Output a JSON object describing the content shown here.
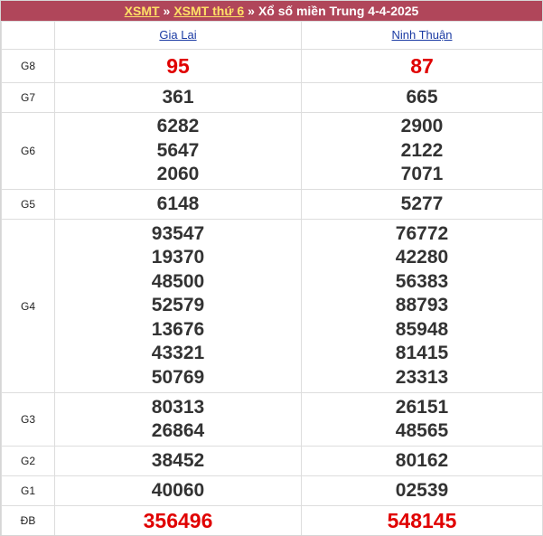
{
  "breadcrumb": {
    "link1": "XSMT",
    "separator": "»",
    "link2": "XSMT thứ 6",
    "title": "Xổ số miền Trung 4-4-2025"
  },
  "provinces": [
    "Gia Lai",
    "Ninh Thuận"
  ],
  "prizes": [
    {
      "label": "G8",
      "p1": [
        "95"
      ],
      "p2": [
        "87"
      ]
    },
    {
      "label": "G7",
      "p1": [
        "361"
      ],
      "p2": [
        "665"
      ]
    },
    {
      "label": "G6",
      "p1": [
        "6282",
        "5647",
        "2060"
      ],
      "p2": [
        "2900",
        "2122",
        "7071"
      ]
    },
    {
      "label": "G5",
      "p1": [
        "6148"
      ],
      "p2": [
        "5277"
      ]
    },
    {
      "label": "G4",
      "p1": [
        "93547",
        "19370",
        "48500",
        "52579",
        "13676",
        "43321",
        "50769"
      ],
      "p2": [
        "76772",
        "42280",
        "56383",
        "88793",
        "85948",
        "81415",
        "23313"
      ]
    },
    {
      "label": "G3",
      "p1": [
        "80313",
        "26864"
      ],
      "p2": [
        "26151",
        "48565"
      ]
    },
    {
      "label": "G2",
      "p1": [
        "38452"
      ],
      "p2": [
        "80162"
      ]
    },
    {
      "label": "G1",
      "p1": [
        "40060"
      ],
      "p2": [
        "02539"
      ]
    },
    {
      "label": "ĐB",
      "p1": [
        "356496"
      ],
      "p2": [
        "548145"
      ]
    }
  ],
  "colors": {
    "header_bg": "#b0465a",
    "crumb": "#ffe066",
    "special": "#e00000",
    "link": "#1a3aa3"
  }
}
